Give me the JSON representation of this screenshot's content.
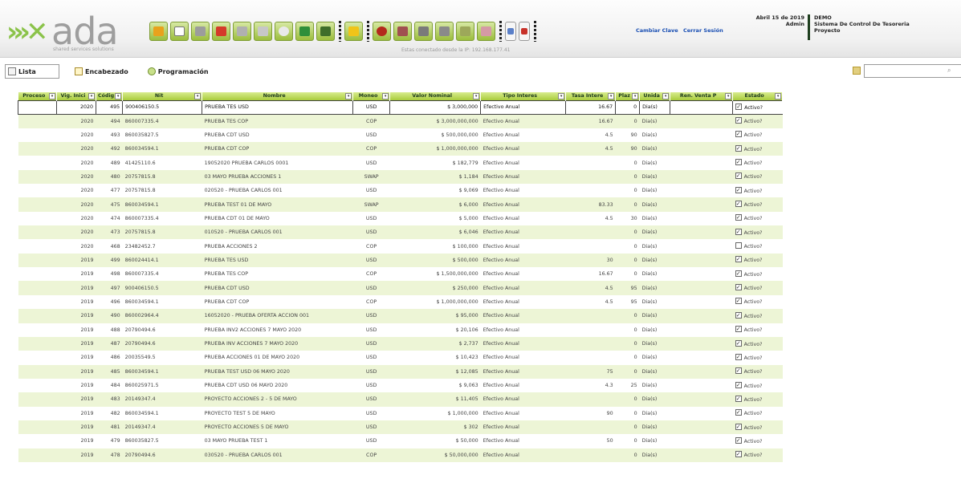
{
  "header": {
    "logo_text": "ada",
    "logo_tagline": "shared services solutions",
    "connection_text": "Estas conectado desde la IP: 192.168.177.41",
    "date": "Abril 15 de 2019",
    "user_label": "Admin",
    "company": "DEMO",
    "system_name": "Sistema De Control De Tesoreria",
    "project_label": "Proyecto",
    "change_password": "Cambiar Clave",
    "logout": "Cerrar Sesión"
  },
  "tabs": [
    {
      "label": "Lista"
    },
    {
      "label": "Encabezado"
    },
    {
      "label": "Programación"
    }
  ],
  "search": {
    "placeholder": ""
  },
  "grid": {
    "columns": [
      "Proceso",
      "Vig. Inici",
      "Códig",
      "Nit",
      "Nombre",
      "Moneo",
      "Valor Nominal",
      "Tipo Interes",
      "Tasa Intere",
      "Plaz",
      "Unida",
      "Ren. Venta P",
      "Estado"
    ],
    "rows": [
      [
        "",
        "2020",
        "495",
        "900406150.5",
        "PRUEBA TES USD",
        "USD",
        "$ 3,000,000",
        "Efectivo Anual",
        "16.67",
        "0",
        "Dia(s)",
        "",
        "Activo?"
      ],
      [
        "",
        "2020",
        "494",
        "860007335.4",
        "PRUEBA TES COP",
        "COP",
        "$ 3,000,000,000",
        "Efectivo Anual",
        "16.67",
        "0",
        "Dia(s)",
        "",
        "Activo?"
      ],
      [
        "",
        "2020",
        "493",
        "860035827.5",
        "PRUEBA CDT USD",
        "USD",
        "$ 500,000,000",
        "Efectivo Anual",
        "4.5",
        "90",
        "Dia(s)",
        "",
        "Activo?"
      ],
      [
        "",
        "2020",
        "492",
        "860034594.1",
        "PRUEBA CDT COP",
        "COP",
        "$ 1,000,000,000",
        "Efectivo Anual",
        "4.5",
        "90",
        "Dia(s)",
        "",
        "Activo?"
      ],
      [
        "",
        "2020",
        "489",
        "41425110.6",
        "19052020 PRUEBA CARLOS 0001",
        "USD",
        "$ 182,779",
        "Efectivo Anual",
        "",
        "0",
        "Dia(s)",
        "",
        "Activo?"
      ],
      [
        "",
        "2020",
        "480",
        "20757815.8",
        "03 MAYO PRUEBA ACCIONES 1",
        "SWAP",
        "$ 1,184",
        "Efectivo Anual",
        "",
        "0",
        "Dia(s)",
        "",
        "Activo?"
      ],
      [
        "",
        "2020",
        "477",
        "20757815.8",
        "020520 - PRUEBA CARLOS 001",
        "USD",
        "$ 9,069",
        "Efectivo Anual",
        "",
        "0",
        "Dia(s)",
        "",
        "Activo?"
      ],
      [
        "",
        "2020",
        "475",
        "860034594.1",
        "PRUEBA TEST 01 DE MAYO",
        "SWAP",
        "$ 6,000",
        "Efectivo Anual",
        "83.33",
        "0",
        "Dia(s)",
        "",
        "Activo?"
      ],
      [
        "",
        "2020",
        "474",
        "860007335.4",
        "PRUEBA CDT 01 DE MAYO",
        "USD",
        "$ 5,000",
        "Efectivo Anual",
        "4.5",
        "30",
        "Dia(s)",
        "",
        "Activo?"
      ],
      [
        "",
        "2020",
        "473",
        "20757815.8",
        "010520 - PRUEBA CARLOS 001",
        "USD",
        "$ 6,046",
        "Efectivo Anual",
        "",
        "0",
        "Dia(s)",
        "",
        "Activo?"
      ],
      [
        "",
        "2020",
        "468",
        "23482452.7",
        "PRUEBA ACCIONES 2",
        "COP",
        "$ 100,000",
        "Efectivo Anual",
        "",
        "0",
        "Dia(s)",
        "",
        "Activo?"
      ],
      [
        "",
        "2019",
        "499",
        "860024414.1",
        "PRUEBA TES USD",
        "USD",
        "$ 500,000",
        "Efectivo Anual",
        "30",
        "0",
        "Dia(s)",
        "",
        "Activo?"
      ],
      [
        "",
        "2019",
        "498",
        "860007335.4",
        "PRUEBA TES COP",
        "COP",
        "$ 1,500,000,000",
        "Efectivo Anual",
        "16.67",
        "0",
        "Dia(s)",
        "",
        "Activo?"
      ],
      [
        "",
        "2019",
        "497",
        "900406150.5",
        "PRUEBA CDT USD",
        "USD",
        "$ 250,000",
        "Efectivo Anual",
        "4.5",
        "95",
        "Dia(s)",
        "",
        "Activo?"
      ],
      [
        "",
        "2019",
        "496",
        "860034594.1",
        "PRUEBA CDT COP",
        "COP",
        "$ 1,000,000,000",
        "Efectivo Anual",
        "4.5",
        "95",
        "Dia(s)",
        "",
        "Activo?"
      ],
      [
        "",
        "2019",
        "490",
        "860002964.4",
        "16052020 - PRUEBA OFERTA ACCION 001",
        "USD",
        "$ 95,000",
        "Efectivo Anual",
        "",
        "0",
        "Dia(s)",
        "",
        "Activo?"
      ],
      [
        "",
        "2019",
        "488",
        "20790494.6",
        "PRUEBA INV2 ACCIONES 7 MAYO 2020",
        "USD",
        "$ 20,106",
        "Efectivo Anual",
        "",
        "0",
        "Dia(s)",
        "",
        "Activo?"
      ],
      [
        "",
        "2019",
        "487",
        "20790494.6",
        "PRUEBA INV ACCIONES 7 MAYO 2020",
        "USD",
        "$ 2,737",
        "Efectivo Anual",
        "",
        "0",
        "Dia(s)",
        "",
        "Activo?"
      ],
      [
        "",
        "2019",
        "486",
        "20035549.5",
        "PRUEBA ACCIONES 01 DE MAYO 2020",
        "USD",
        "$ 10,423",
        "Efectivo Anual",
        "",
        "0",
        "Dia(s)",
        "",
        "Activo?"
      ],
      [
        "",
        "2019",
        "485",
        "860034594.1",
        "PRUEBA TEST USD 06 MAYO 2020",
        "USD",
        "$ 12,085",
        "Efectivo Anual",
        "75",
        "0",
        "Dia(s)",
        "",
        "Activo?"
      ],
      [
        "",
        "2019",
        "484",
        "860025971.5",
        "PRUEBA CDT USD 06 MAYO 2020",
        "USD",
        "$ 9,063",
        "Efectivo Anual",
        "4.3",
        "25",
        "Dia(s)",
        "",
        "Activo?"
      ],
      [
        "",
        "2019",
        "483",
        "20149347.4",
        "PROYECTO ACCIONES 2 - 5 DE MAYO",
        "USD",
        "$ 11,405",
        "Efectivo Anual",
        "",
        "0",
        "Dia(s)",
        "",
        "Activo?"
      ],
      [
        "",
        "2019",
        "482",
        "860034594.1",
        "PROYECTO TEST 5 DE MAYO",
        "USD",
        "$ 1,000,000",
        "Efectivo Anual",
        "90",
        "0",
        "Dia(s)",
        "",
        "Activo?"
      ],
      [
        "",
        "2019",
        "481",
        "20149347.4",
        "PROYECTO ACCIONES 5 DE MAYO",
        "USD",
        "$ 302",
        "Efectivo Anual",
        "",
        "0",
        "Dia(s)",
        "",
        "Activo?"
      ],
      [
        "",
        "2019",
        "479",
        "860035827.5",
        "03 MAYO PRUEBA TEST 1",
        "USD",
        "$ 50,000",
        "Efectivo Anual",
        "50",
        "0",
        "Dia(s)",
        "",
        "Activo?"
      ],
      [
        "",
        "2019",
        "478",
        "20790494.6",
        "030520 - PRUEBA CARLOS 001",
        "COP",
        "$ 50,000,000",
        "Efectivo Anual",
        "",
        "0",
        "Dia(s)",
        "",
        "Activo?"
      ]
    ],
    "checked": [
      true,
      true,
      true,
      true,
      true,
      true,
      true,
      true,
      true,
      true,
      false,
      true,
      true,
      true,
      true,
      true,
      true,
      true,
      true,
      true,
      true,
      true,
      true,
      true,
      true,
      true
    ]
  }
}
